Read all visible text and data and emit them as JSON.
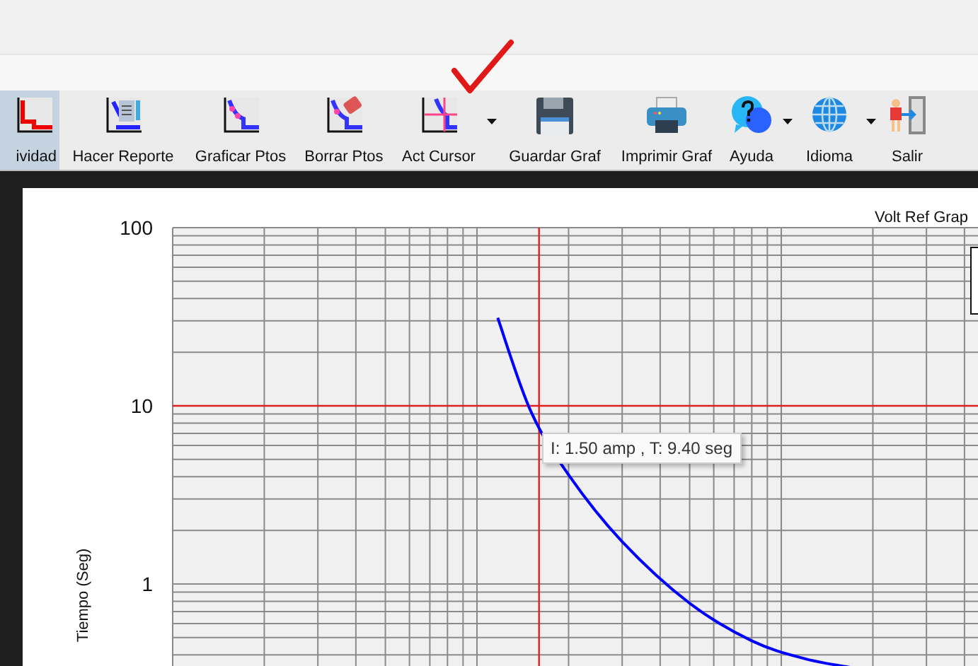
{
  "toolbar": {
    "items": [
      {
        "label": "ividad",
        "kind": "chart",
        "selected": true,
        "dropdown": false
      },
      {
        "label": "Hacer Reporte",
        "kind": "report",
        "selected": false,
        "dropdown": false
      },
      {
        "label": "Graficar Ptos",
        "kind": "plot",
        "selected": false,
        "dropdown": false
      },
      {
        "label": "Borrar Ptos",
        "kind": "erase",
        "selected": false,
        "dropdown": false
      },
      {
        "label": "Act Cursor",
        "kind": "cursor",
        "selected": false,
        "dropdown": true
      },
      {
        "label": "Guardar Graf",
        "kind": "save",
        "selected": false,
        "dropdown": false
      },
      {
        "label": "Imprimir Graf",
        "kind": "print",
        "selected": false,
        "dropdown": false
      },
      {
        "label": "Ayuda",
        "kind": "help",
        "selected": false,
        "dropdown": true
      },
      {
        "label": "Idioma",
        "kind": "language",
        "selected": false,
        "dropdown": true
      },
      {
        "label": "Salir",
        "kind": "exit",
        "selected": false,
        "dropdown": false
      }
    ]
  },
  "chart": {
    "title": "Volt Ref Grap",
    "y_axis_label": "Tiempo (Seg)",
    "y_ticks": [
      "100",
      "10",
      "1"
    ],
    "tooltip": "I: 1.50 amp , T: 9.40 seg"
  }
}
